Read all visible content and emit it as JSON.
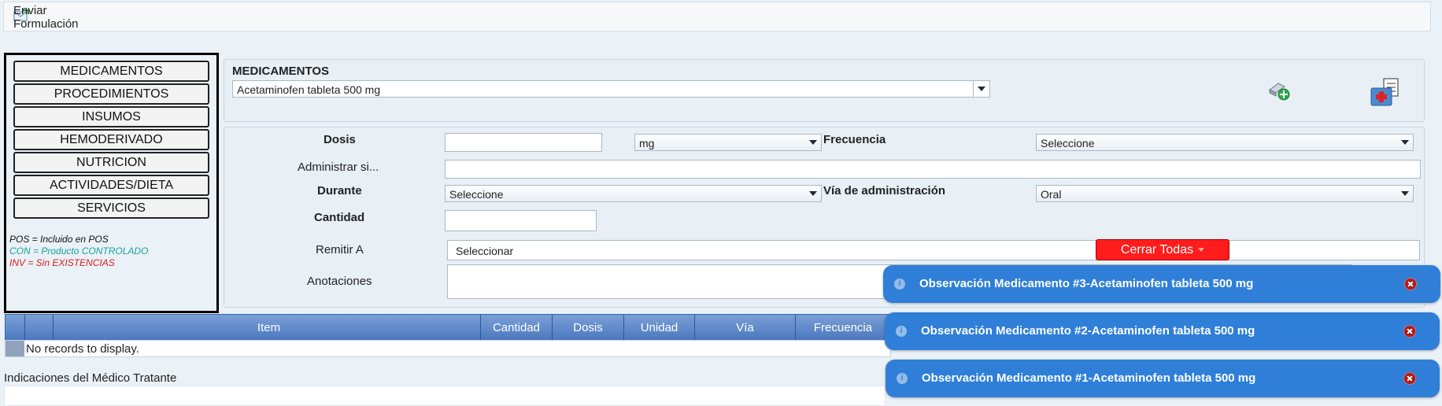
{
  "toolbar": {
    "send_label": "Enviar Formulación",
    "send_icon": "envelope-send-icon"
  },
  "nav": {
    "items": [
      "MEDICAMENTOS",
      "PROCEDIMIENTOS",
      "INSUMOS",
      "HEMODERIVADO",
      "NUTRICION",
      "ACTIVIDADES/DIETA",
      "SERVICIOS"
    ]
  },
  "legend": {
    "pos": "POS = Incluido en POS",
    "con": "CON = Producto CONTROLADO",
    "inv": "INV = Sin EXISTENCIAS",
    "colors": {
      "pos": "#111111",
      "con": "#1aa39a",
      "inv": "#e01b1b"
    }
  },
  "medicamentos": {
    "title": "MEDICAMENTOS",
    "selected": "Acetaminofen tableta 500 mg",
    "add_icon": "add-medication-icon",
    "kit_icon": "medical-kit-checklist-icon"
  },
  "form": {
    "dosis_label": "Dosis",
    "dosis_value": "",
    "dosis_unit": "mg",
    "frecuencia_label": "Frecuencia",
    "frecuencia_value": "Seleccione",
    "administrar_label": "Administrar si...",
    "administrar_value": "",
    "durante_label": "Durante",
    "durante_value": "Seleccione",
    "via_label": "Vía de administración",
    "via_value": "Oral",
    "cantidad_label": "Cantidad",
    "cantidad_value": "",
    "remitir_label": "Remitir A",
    "remitir_value": "Seleccionar",
    "anotaciones_label": "Anotaciones",
    "anotaciones_value": ""
  },
  "cerrar_label": "Cerrar Todas",
  "grid": {
    "columns": [
      "Item",
      "Cantidad",
      "Dosis",
      "Unidad",
      "Vía",
      "Frecuencia"
    ],
    "empty_text": "No records to display."
  },
  "indicaciones_label": "Indicaciones del Médico Tratante",
  "toasts": [
    {
      "message": "Observación Medicamento #3-Acetaminofen tableta 500 mg"
    },
    {
      "message": "Observación Medicamento #2-Acetaminofen tableta 500 mg"
    },
    {
      "message": "Observación Medicamento #1-Acetaminofen tableta 500 mg"
    }
  ],
  "colors": {
    "toast": "#2f7fd9",
    "grid_header": "#4a77bf",
    "cerrar": "#ff1c1c"
  }
}
